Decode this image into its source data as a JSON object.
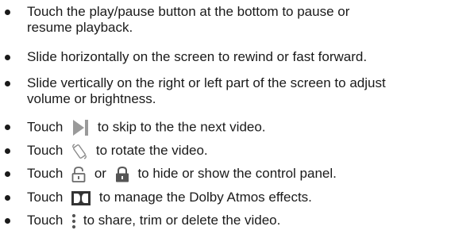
{
  "items": [
    {
      "line1": "Touch the play/pause button at the bottom to pause or",
      "line2": "resume playback."
    },
    {
      "text": "Slide horizontally on the screen to rewind or fast forward."
    },
    {
      "line1": "Slide vertically on the right or left part of the screen to adjust",
      "line2": "volume or brightness."
    },
    {
      "before": "Touch",
      "icon": "skip-next-icon",
      "after": "to skip to the the next video."
    },
    {
      "before": "Touch",
      "icon": "rotate-icon",
      "after": "to rotate the video."
    },
    {
      "before": "Touch",
      "icon": "unlock-icon",
      "middle": "or",
      "icon2": "lock-icon",
      "after": "to hide or show the control panel."
    },
    {
      "before": "Touch",
      "icon": "dolby-icon",
      "after": "to manage the Dolby Atmos effects."
    },
    {
      "before": "Touch",
      "icon": "more-options-icon",
      "after": "to share, trim or delete the video."
    }
  ],
  "colors": {
    "text": "#1a1a1a",
    "icon": "#9a9a9a",
    "icon_dark": "#333333"
  }
}
